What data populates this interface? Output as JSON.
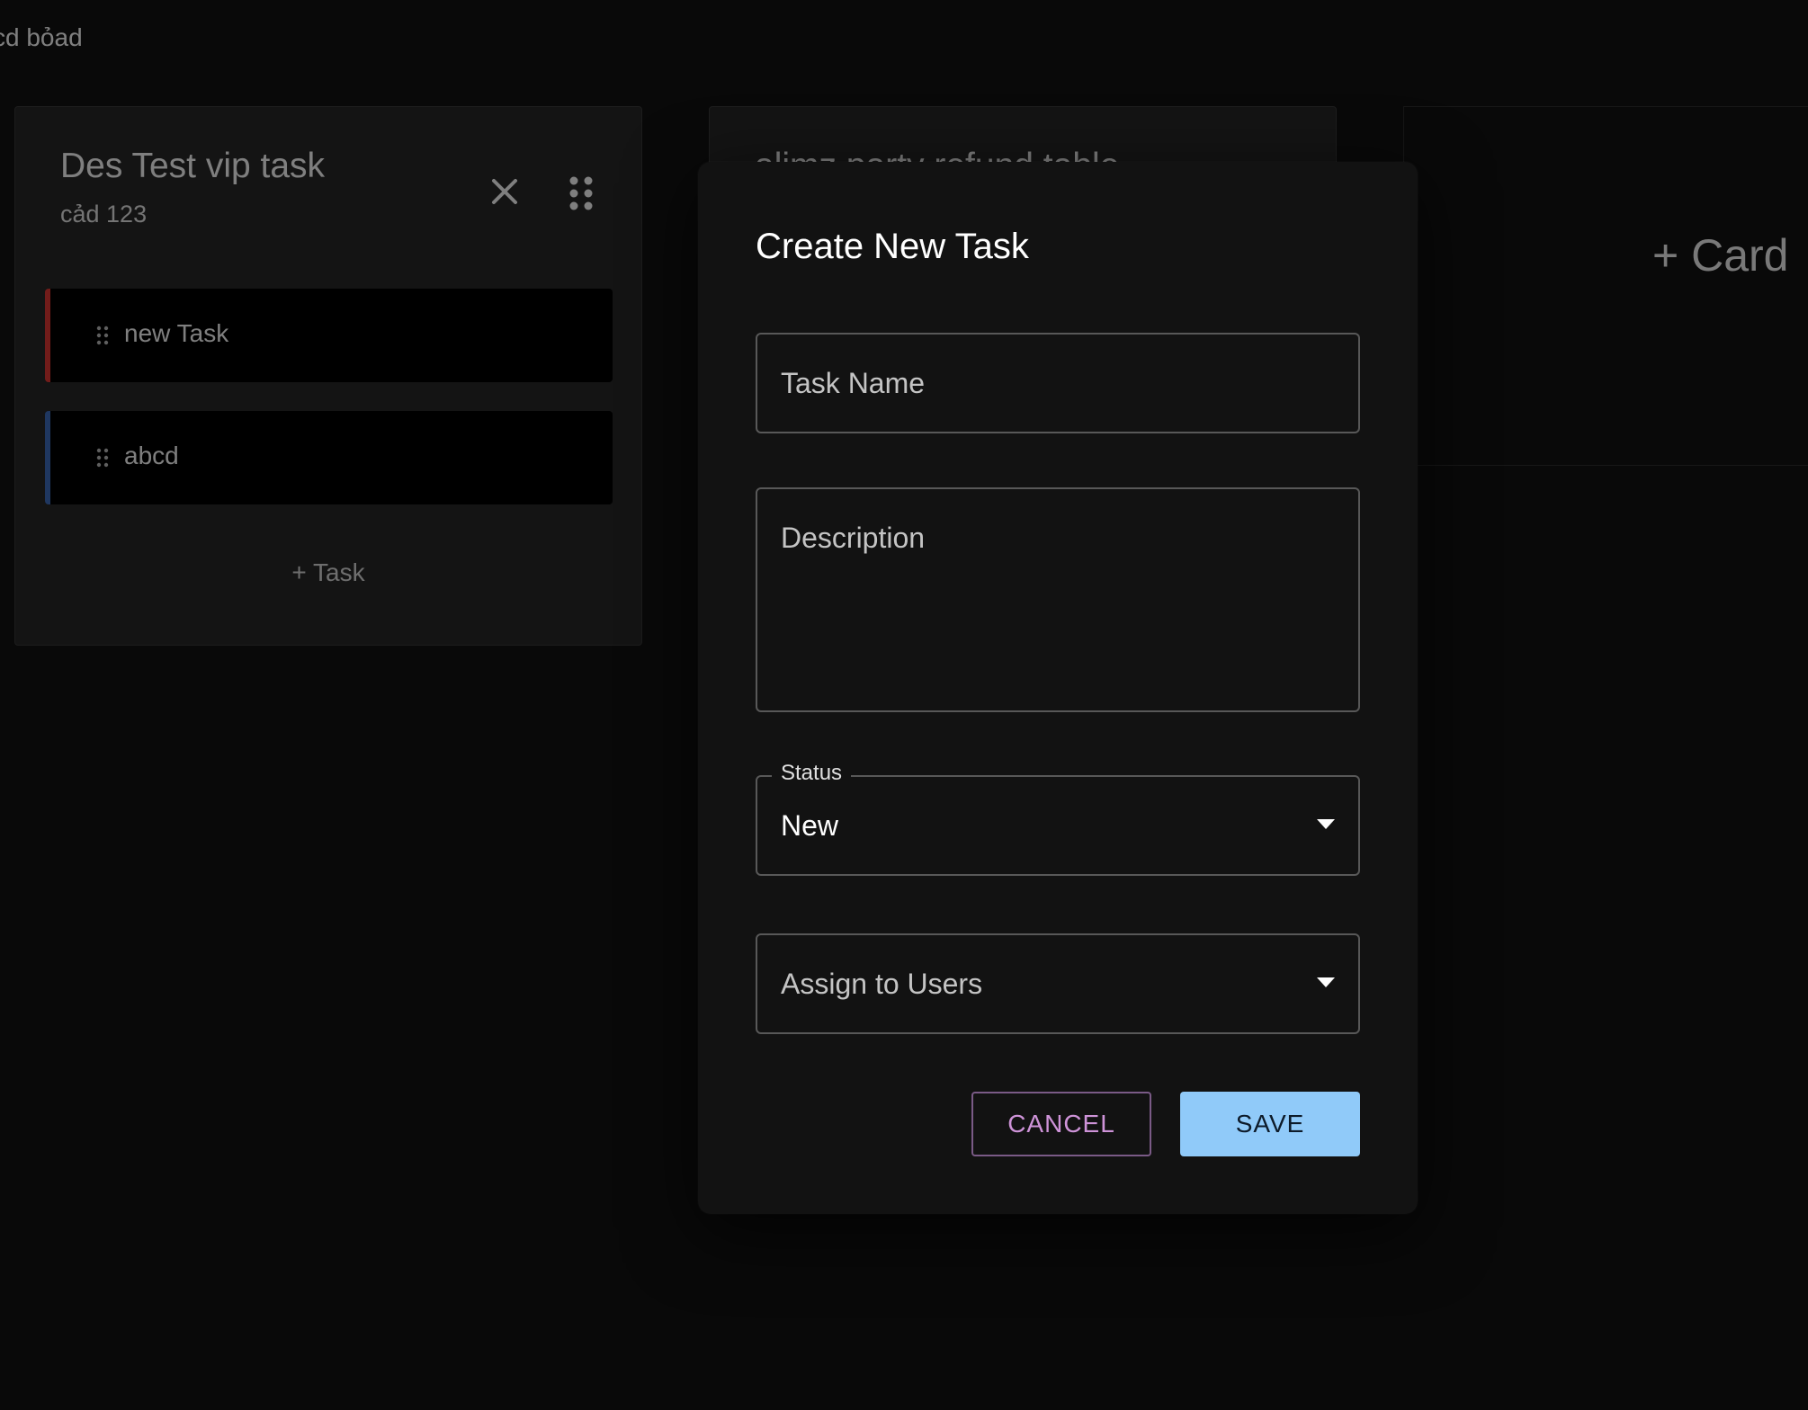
{
  "board": {
    "title": "cd bỏad"
  },
  "columns": [
    {
      "title": "Des Test vip task",
      "subtitle": "cảd 123",
      "tasks": [
        {
          "label": "new Task",
          "color": "#e53935"
        },
        {
          "label": "abcd",
          "color": "#3f6fc0"
        }
      ],
      "add_task_label": "+ Task"
    },
    {
      "title": "alimz party refund table"
    }
  ],
  "add_card_label": "+ Card",
  "dialog": {
    "title": "Create New Task",
    "task_name": {
      "placeholder": "Task Name",
      "value": ""
    },
    "description": {
      "placeholder": "Description",
      "value": ""
    },
    "status": {
      "label": "Status",
      "value": "New"
    },
    "assign": {
      "placeholder": "Assign to Users"
    },
    "cancel_label": "CANCEL",
    "save_label": "SAVE"
  },
  "colors": {
    "primary": "#90caf9",
    "secondary": "#ce93d8",
    "background": "#121212",
    "surface": "#282828"
  },
  "icons": {
    "close": "close-icon",
    "drag": "drag-handle-icon",
    "dropdown": "arrow-drop-down-icon"
  }
}
